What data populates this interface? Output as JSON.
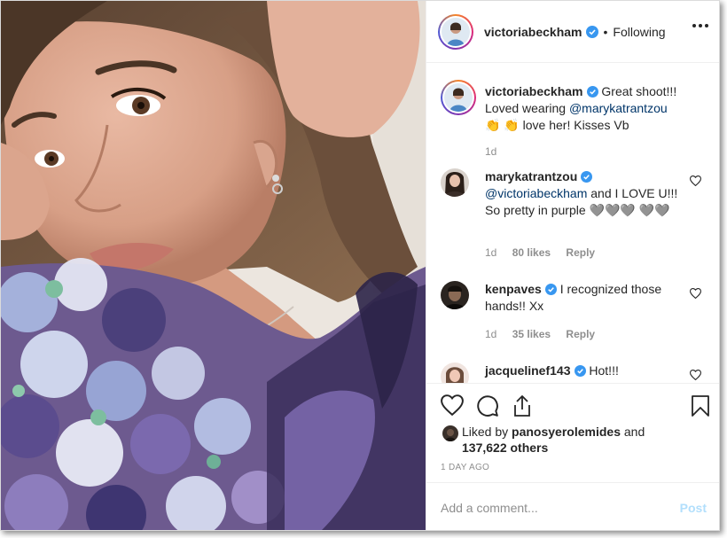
{
  "header": {
    "username": "victoriabeckham",
    "separator": "•",
    "follow_status": "Following"
  },
  "comments": [
    {
      "username": "victoriabeckham",
      "verified": true,
      "text_parts": [
        "Great shoot!!! Loved wearing ",
        "@marykatrantzou",
        " 👏 👏 love her! Kisses Vb"
      ],
      "time": "1d"
    },
    {
      "username": "marykatrantzou",
      "verified": true,
      "text_parts": [
        "",
        "@victoriabeckham",
        " and I LOVE U!!! So pretty in purple 🩶🩶🩶 🩶🩶"
      ],
      "time": "1d",
      "likes": "80 likes",
      "reply": "Reply"
    },
    {
      "username": "kenpaves",
      "verified": true,
      "text_parts": [
        "I recognized those hands!! Xx"
      ],
      "time": "1d",
      "likes": "35 likes",
      "reply": "Reply"
    },
    {
      "username": "jacquelinef143",
      "verified": true,
      "text_parts": [
        "Hot!!!"
      ]
    }
  ],
  "likes": {
    "prefix": "Liked by",
    "user": "panosyerolemides",
    "and": "and",
    "count": "137,622 others"
  },
  "time_ago": "1 DAY AGO",
  "comment_box": {
    "placeholder": "Add a comment...",
    "post_label": "Post"
  },
  "colors": {
    "verified": "#3897f0",
    "mention": "#003569",
    "muted": "#8e8e8e",
    "post_disabled": "#b2dffc"
  },
  "icons": [
    "heart-icon",
    "comment-icon",
    "share-icon",
    "bookmark-icon",
    "more-options-icon",
    "verified-badge-icon"
  ]
}
